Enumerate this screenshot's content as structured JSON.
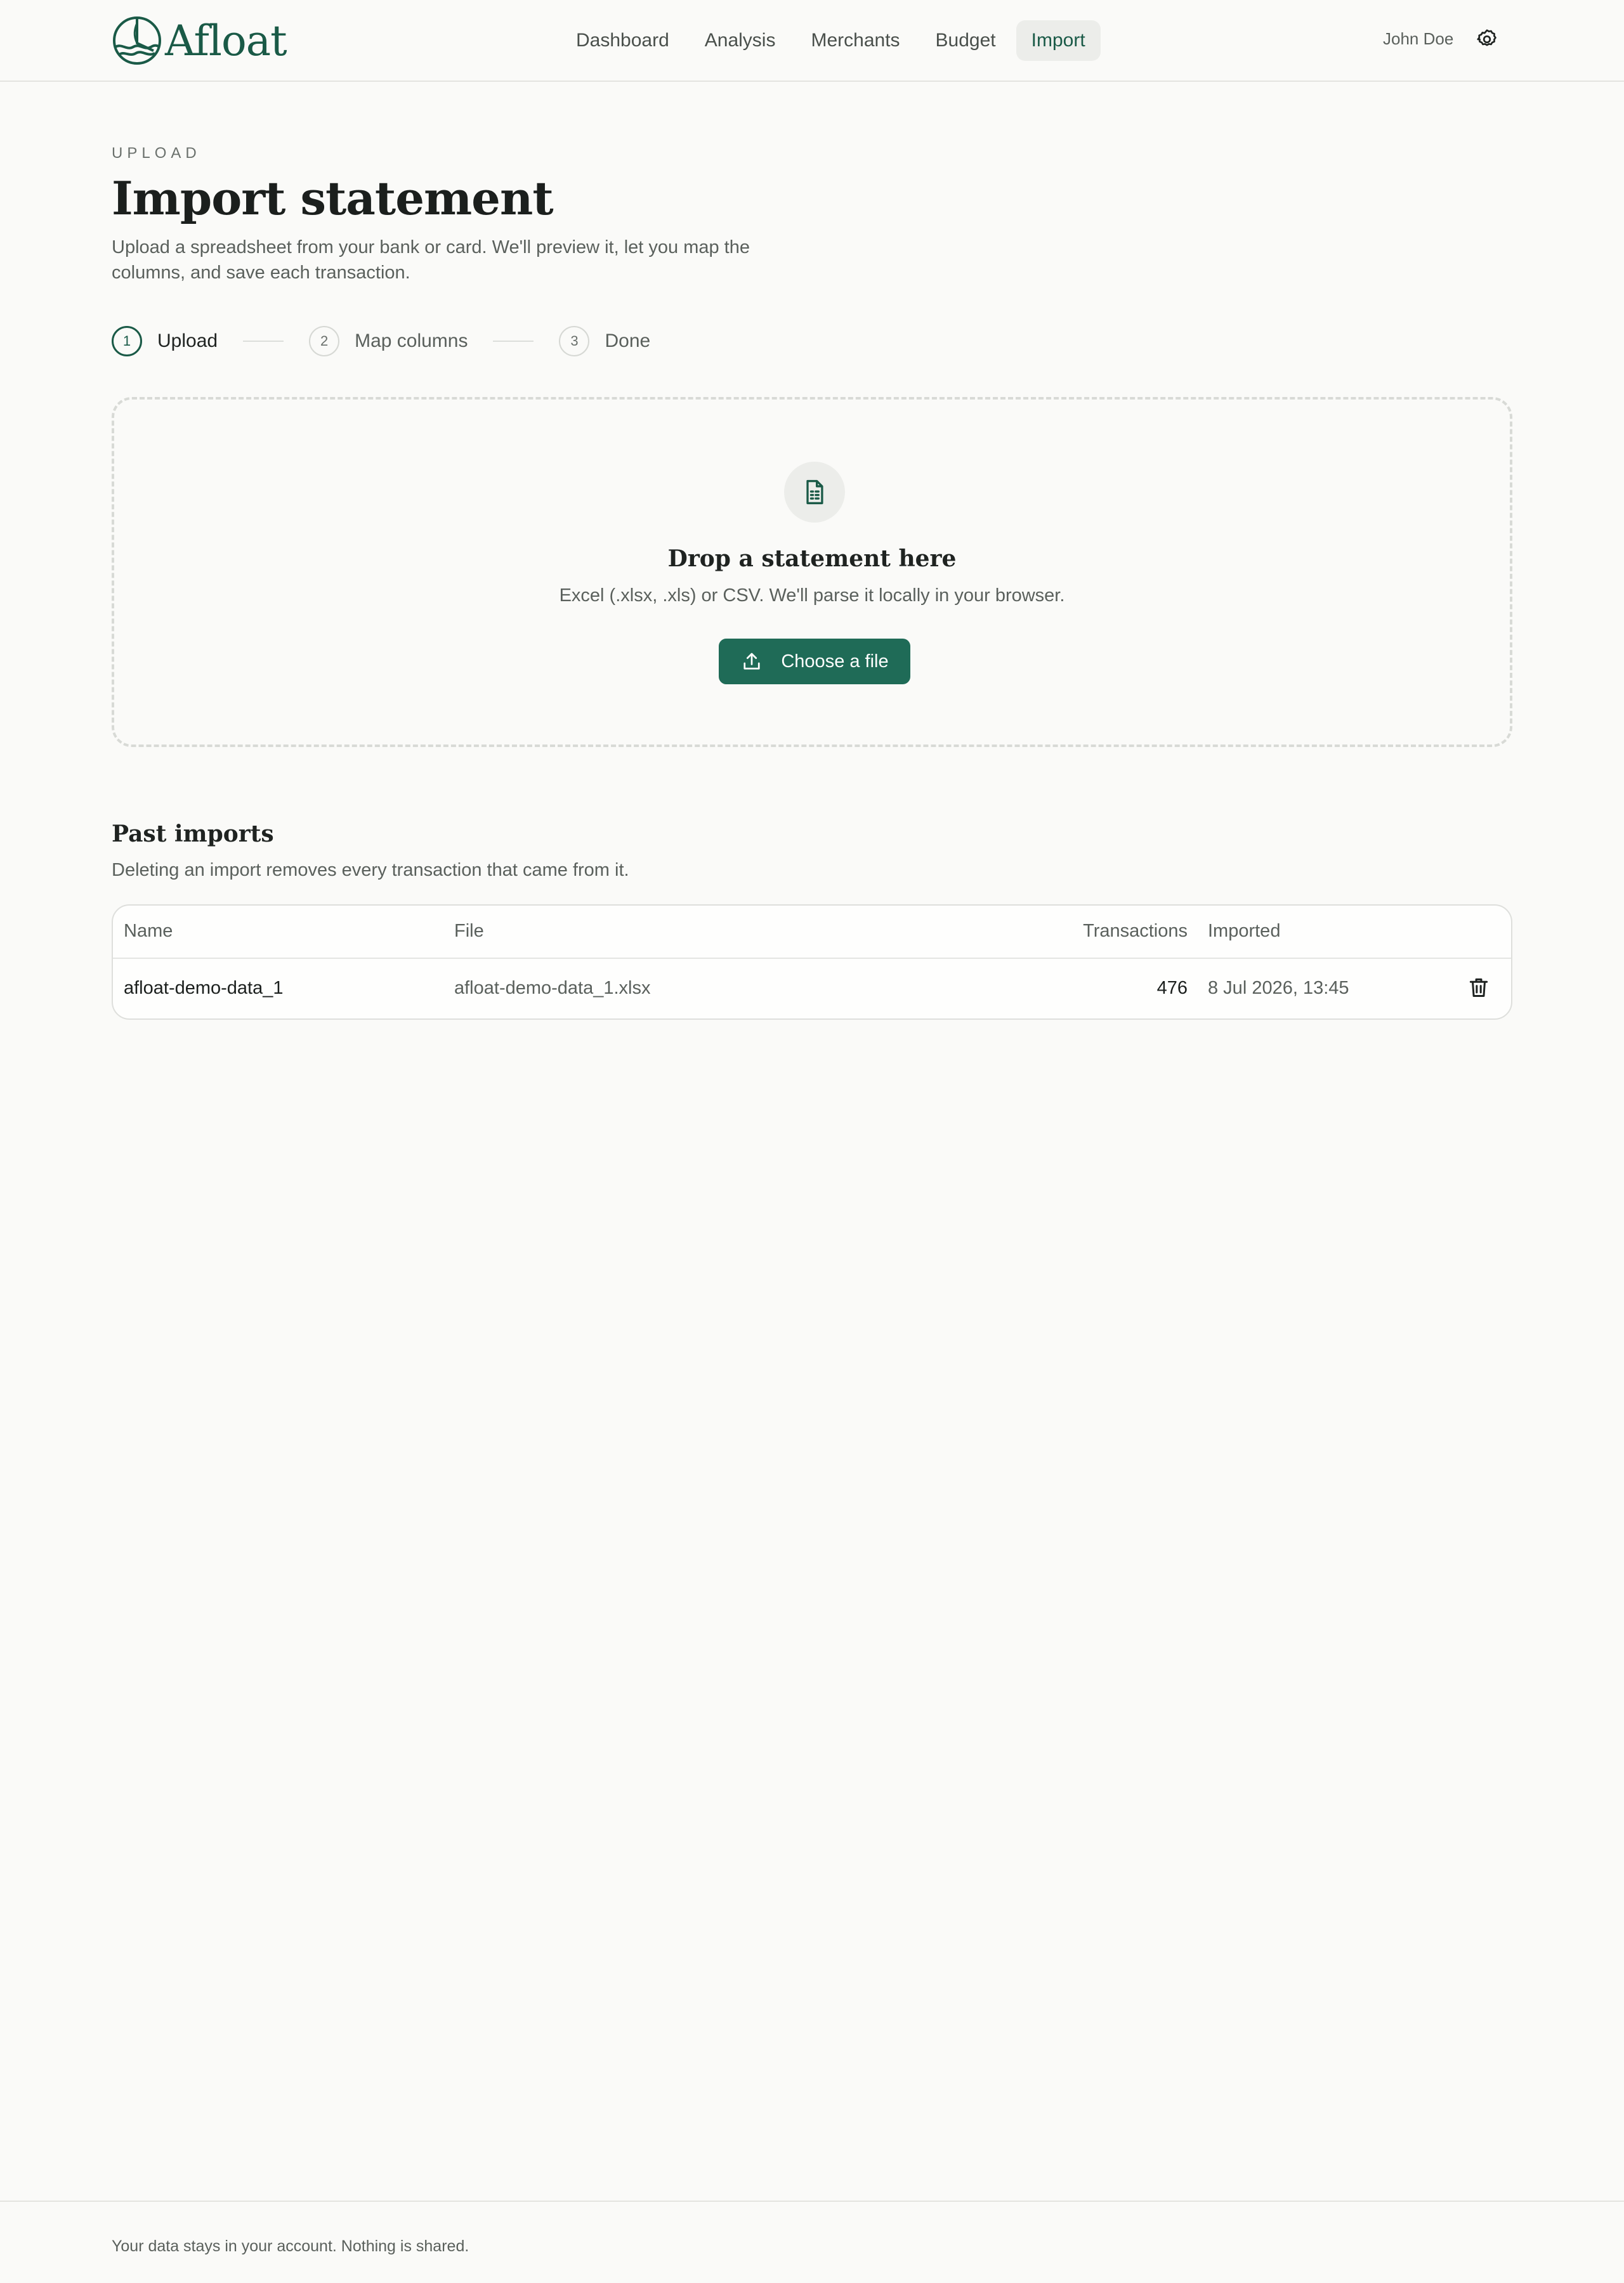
{
  "brand": {
    "name": "Afloat",
    "color": "#1a5a47"
  },
  "nav": {
    "items": [
      {
        "label": "Dashboard",
        "active": false
      },
      {
        "label": "Analysis",
        "active": false
      },
      {
        "label": "Merchants",
        "active": false
      },
      {
        "label": "Budget",
        "active": false
      },
      {
        "label": "Import",
        "active": true
      }
    ]
  },
  "user": {
    "name": "John Doe",
    "settings_icon": "gear-icon"
  },
  "page": {
    "eyebrow": "UPLOAD",
    "title": "Import statement",
    "description": "Upload a spreadsheet from your bank or card. We'll preview it, let you map the columns, and save each transaction."
  },
  "steps": [
    {
      "number": "1",
      "label": "Upload",
      "active": true
    },
    {
      "number": "2",
      "label": "Map columns",
      "active": false
    },
    {
      "number": "3",
      "label": "Done",
      "active": false
    }
  ],
  "dropzone": {
    "icon": "spreadsheet-file-icon",
    "title": "Drop a statement here",
    "subtitle": "Excel (.xlsx, .xls) or CSV. We'll parse it locally in your browser.",
    "button_label": "Choose a file",
    "button_icon": "upload-icon",
    "button_color": "#1f6b57"
  },
  "past_imports": {
    "title": "Past imports",
    "description": "Deleting an import removes every transaction that came from it.",
    "columns": [
      "Name",
      "File",
      "Transactions",
      "Imported"
    ],
    "rows": [
      {
        "name": "afloat-demo-data_1",
        "file": "afloat-demo-data_1.xlsx",
        "transactions": "476",
        "imported": "8 Jul 2026, 13:45",
        "action_icon": "trash-icon"
      }
    ]
  },
  "footer": {
    "text": "Your data stays in your account. Nothing is shared."
  }
}
